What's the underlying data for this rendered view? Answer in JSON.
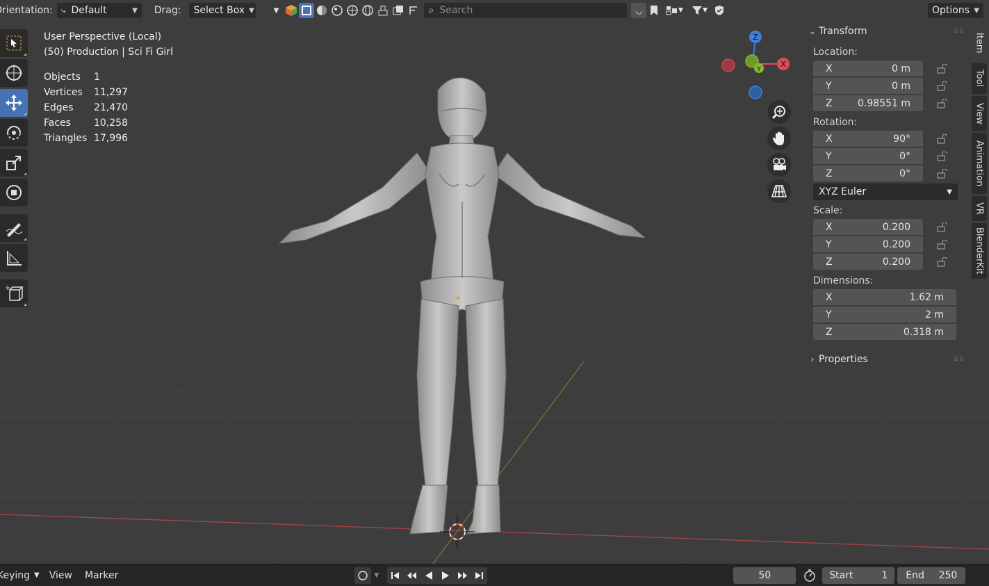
{
  "header": {
    "orientation_label": "Orientation:",
    "orientation_value": "Default",
    "drag_label": "Drag:",
    "drag_value": "Select Box",
    "search_placeholder": "Search",
    "options_label": "Options"
  },
  "overlay": {
    "view_name": "User Perspective (Local)",
    "collection": "(50) Production | Sci Fi Girl",
    "stats": [
      {
        "label": "Objects",
        "value": "1"
      },
      {
        "label": "Vertices",
        "value": "11,297"
      },
      {
        "label": "Edges",
        "value": "21,470"
      },
      {
        "label": "Faces",
        "value": "10,258"
      },
      {
        "label": "Triangles",
        "value": "17,996"
      }
    ]
  },
  "gizmo": {
    "z_label": "Z",
    "x_label": "X",
    "y_label": "Y",
    "x_color": "#e04a5a",
    "y_color": "#85b830",
    "z_color": "#3d7fd9"
  },
  "npanel": {
    "transform_title": "Transform",
    "location_label": "Location:",
    "location": [
      {
        "axis": "X",
        "value": "0 m"
      },
      {
        "axis": "Y",
        "value": "0 m"
      },
      {
        "axis": "Z",
        "value": "0.98551 m"
      }
    ],
    "rotation_label": "Rotation:",
    "rotation": [
      {
        "axis": "X",
        "value": "90°"
      },
      {
        "axis": "Y",
        "value": "0°"
      },
      {
        "axis": "Z",
        "value": "0°"
      }
    ],
    "rotation_mode": "XYZ Euler",
    "scale_label": "Scale:",
    "scale": [
      {
        "axis": "X",
        "value": "0.200"
      },
      {
        "axis": "Y",
        "value": "0.200"
      },
      {
        "axis": "Z",
        "value": "0.200"
      }
    ],
    "dimensions_label": "Dimensions:",
    "dimensions": [
      {
        "axis": "X",
        "value": "1.62 m"
      },
      {
        "axis": "Y",
        "value": "2 m"
      },
      {
        "axis": "Z",
        "value": "0.318 m"
      }
    ],
    "properties_title": "Properties"
  },
  "tabs": [
    "Item",
    "Tool",
    "View",
    "Animation",
    "VR",
    "BlenderKit"
  ],
  "timeline": {
    "keying_label": "Keying",
    "view_label": "View",
    "marker_label": "Marker",
    "current_frame": "50",
    "start_label": "Start",
    "start_value": "1",
    "end_label": "End",
    "end_value": "250"
  },
  "colors": {
    "accent": "#4772b3",
    "viewport_bg": "#3d3d3d",
    "field_bg": "#545454"
  }
}
